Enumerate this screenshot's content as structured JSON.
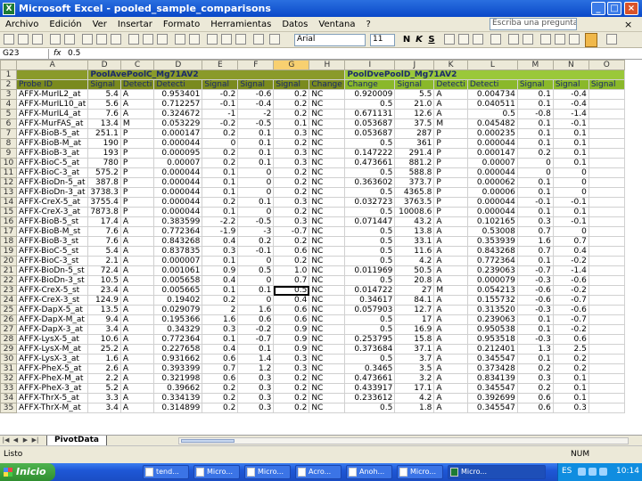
{
  "window": {
    "title": "Microsoft Excel - pooled_sample_comparisons",
    "app_icon_letter": "X",
    "min_label": "_",
    "max_label": "□",
    "close_label": "×"
  },
  "menu": {
    "items": [
      "Archivo",
      "Edición",
      "Ver",
      "Insertar",
      "Formato",
      "Herramientas",
      "Datos",
      "Ventana",
      "?"
    ],
    "help_placeholder": "Escriba una pregunta",
    "close_glyph": "×"
  },
  "toolbar": {
    "font": "Arial",
    "size": "11",
    "bold": "N",
    "italic": "K",
    "underline": "S"
  },
  "formula_bar": {
    "name_box": "G23",
    "fx": "fx",
    "content": "0.5"
  },
  "columns": [
    "",
    "A",
    "D",
    "C",
    "D",
    "E",
    "F",
    "G",
    "H",
    "I",
    "J",
    "K",
    "L",
    "M",
    "N",
    "O"
  ],
  "selected_column": "G",
  "group_row": {
    "row": "1",
    "group1": "PoolAvePoolC_Mg71AV2",
    "group2": "PoolDvePoolD_Mg71AV2"
  },
  "header_row": {
    "row": "2",
    "cells": [
      "Probe ID",
      "Signal",
      "Detecti",
      "Detecti",
      "Signal",
      "Signal",
      "Signal",
      "Change",
      "Change",
      "Signal",
      "Detecti",
      "Detecti",
      "Signal",
      "Signal",
      "Signal"
    ]
  },
  "rows": [
    {
      "n": "3",
      "c": [
        "AFFX-MurIL2_at",
        "5.4",
        "A",
        "0.953401",
        "-0.2",
        "-0.6",
        "0.2",
        "NC",
        "0.920009",
        "5.5",
        "A",
        "0.004734",
        "0.1",
        "-0.4"
      ]
    },
    {
      "n": "4",
      "c": [
        "AFFX-MurIL10_at",
        "5.6",
        "A",
        "0.712257",
        "-0.1",
        "-0.4",
        "0.2",
        "NC",
        "0.5",
        "21.0",
        "A",
        "0.040511",
        "0.1",
        "-0.4"
      ]
    },
    {
      "n": "5",
      "c": [
        "AFFX-MurIL4_at",
        "7.6",
        "A",
        "0.324672",
        "-1",
        "-2",
        "0.2",
        "NC",
        "0.671131",
        "12.6",
        "A",
        "0.5",
        "-0.8",
        "-1.4"
      ]
    },
    {
      "n": "6",
      "c": [
        "AFFX-MurFAS_at",
        "13.4",
        "M",
        "0.053229",
        "-0.2",
        "-0.5",
        "0.1",
        "NC",
        "0.053687",
        "37.5",
        "M",
        "0.045482",
        "0.1",
        "-0.1"
      ]
    },
    {
      "n": "7",
      "c": [
        "AFFX-BioB-5_at",
        "251.1",
        "P",
        "0.000147",
        "0.2",
        "0.1",
        "0.3",
        "NC",
        "0.053687",
        "287",
        "P",
        "0.000235",
        "0.1",
        "0.1"
      ]
    },
    {
      "n": "8",
      "c": [
        "AFFX-BioB-M_at",
        "190",
        "P",
        "0.000044",
        "0",
        "0.1",
        "0.2",
        "NC",
        "0.5",
        "361",
        "P",
        "0.000044",
        "0.1",
        "0.1"
      ]
    },
    {
      "n": "9",
      "c": [
        "AFFX-BioB-3_at",
        "193",
        "P",
        "0.000095",
        "0.2",
        "0.1",
        "0.3",
        "NC",
        "0.147222",
        "291.4",
        "P",
        "0.000147",
        "0.2",
        "0.1"
      ]
    },
    {
      "n": "10",
      "c": [
        "AFFX-BioC-5_at",
        "780",
        "P",
        "0.00007",
        "0.2",
        "0.1",
        "0.3",
        "NC",
        "0.473661",
        "881.2",
        "P",
        "0.00007",
        "0",
        "0.1"
      ]
    },
    {
      "n": "11",
      "c": [
        "AFFX-BioC-3_at",
        "575.2",
        "P",
        "0.000044",
        "0.1",
        "0",
        "0.2",
        "NC",
        "0.5",
        "588.8",
        "P",
        "0.000044",
        "0",
        "0"
      ]
    },
    {
      "n": "12",
      "c": [
        "AFFX-BioDn-5_at",
        "387.8",
        "P",
        "0.000044",
        "0.1",
        "0",
        "0.2",
        "NC",
        "0.363602",
        "373.7",
        "P",
        "0.000062",
        "0.1",
        "0"
      ]
    },
    {
      "n": "13",
      "c": [
        "AFFX-BioDn-3_at",
        "3738.3",
        "P",
        "0.000044",
        "0.1",
        "0",
        "0.2",
        "NC",
        "0.5",
        "4365.8",
        "P",
        "0.00006",
        "0.1",
        "0"
      ]
    },
    {
      "n": "14",
      "c": [
        "AFFX-CreX-5_at",
        "3755.4",
        "P",
        "0.000044",
        "0.2",
        "0.1",
        "0.3",
        "NC",
        "0.032723",
        "3763.5",
        "P",
        "0.000044",
        "-0.1",
        "-0.1"
      ]
    },
    {
      "n": "15",
      "c": [
        "AFFX-CreX-3_at",
        "7873.8",
        "P",
        "0.000044",
        "0.1",
        "0",
        "0.2",
        "NC",
        "0.5",
        "10008.6",
        "P",
        "0.000044",
        "0.1",
        "0.1"
      ]
    },
    {
      "n": "16",
      "c": [
        "AFFX-BioB-5_st",
        "17.4",
        "A",
        "0.383599",
        "-2.2",
        "-0.5",
        "0.3",
        "NC",
        "0.071447",
        "43.2",
        "A",
        "0.102165",
        "0.3",
        "-0.1"
      ]
    },
    {
      "n": "17",
      "c": [
        "AFFX-BioB-M_st",
        "7.6",
        "A",
        "0.772364",
        "-1.9",
        "-3",
        "-0.7",
        "NC",
        "0.5",
        "13.8",
        "A",
        "0.53008",
        "0.7",
        "0"
      ]
    },
    {
      "n": "18",
      "c": [
        "AFFX-BioB-3_st",
        "7.6",
        "A",
        "0.843268",
        "0.4",
        "0.2",
        "0.2",
        "NC",
        "0.5",
        "33.1",
        "A",
        "0.353939",
        "1.6",
        "0.7"
      ]
    },
    {
      "n": "19",
      "c": [
        "AFFX-BioC-5_st",
        "5.4",
        "A",
        "0.837835",
        "0.3",
        "-0.1",
        "0.6",
        "NC",
        "0.5",
        "11.6",
        "A",
        "0.843268",
        "0.7",
        "0.4"
      ]
    },
    {
      "n": "20",
      "c": [
        "AFFX-BioC-3_st",
        "2.1",
        "A",
        "0.000007",
        "0.1",
        "0",
        "0.2",
        "NC",
        "0.5",
        "4.2",
        "A",
        "0.772364",
        "0.1",
        "-0.2"
      ]
    },
    {
      "n": "21",
      "c": [
        "AFFX-BioDn-5_st",
        "72.4",
        "A",
        "0.001061",
        "0.9",
        "0.5",
        "1.0",
        "NC",
        "0.011969",
        "50.5",
        "A",
        "0.239063",
        "-0.7",
        "-1.4"
      ]
    },
    {
      "n": "22",
      "c": [
        "AFFX-BioDn-3_st",
        "10.5",
        "A",
        "0.005658",
        "0.4",
        "0",
        "0.7",
        "NC",
        "0.5",
        "20.8",
        "A",
        "0.000079",
        "-0.3",
        "-0.6"
      ]
    },
    {
      "n": "23",
      "c": [
        "AFFX-CreX-5_st",
        "23.4",
        "A",
        "0.005665",
        "0.1",
        "0.1",
        "0.5",
        "NC",
        "0.014722",
        "27",
        "M",
        "0.054213",
        "-0.6",
        "-0.2"
      ]
    },
    {
      "n": "24",
      "c": [
        "AFFX-CreX-3_st",
        "124.9",
        "A",
        "0.19402",
        "0.2",
        "0",
        "0.4",
        "NC",
        "0.34617",
        "84.1",
        "A",
        "0.155732",
        "-0.6",
        "-0.7"
      ]
    },
    {
      "n": "25",
      "c": [
        "AFFX-DapX-5_at",
        "13.5",
        "A",
        "0.029079",
        "2",
        "1.6",
        "0.6",
        "NC",
        "0.057903",
        "12.7",
        "A",
        "0.313520",
        "-0.3",
        "-0.6"
      ]
    },
    {
      "n": "26",
      "c": [
        "AFFX-DapX-M_at",
        "9.4",
        "A",
        "0.195366",
        "1.6",
        "0.6",
        "0.6",
        "NC",
        "0.5",
        "17",
        "A",
        "0.239063",
        "0.1",
        "-0.7"
      ]
    },
    {
      "n": "27",
      "c": [
        "AFFX-DapX-3_at",
        "3.4",
        "A",
        "0.34329",
        "0.3",
        "-0.2",
        "0.9",
        "NC",
        "0.5",
        "16.9",
        "A",
        "0.950538",
        "0.1",
        "-0.2"
      ]
    },
    {
      "n": "28",
      "c": [
        "AFFX-LysX-5_at",
        "10.6",
        "A",
        "0.772364",
        "0.1",
        "-0.7",
        "0.9",
        "NC",
        "0.253795",
        "15.8",
        "A",
        "0.953518",
        "-0.3",
        "0.6"
      ]
    },
    {
      "n": "29",
      "c": [
        "AFFX-LysX-M_at",
        "25.2",
        "A",
        "0.227658",
        "0.4",
        "0.1",
        "0.9",
        "NC",
        "0.373684",
        "37.1",
        "A",
        "0.212401",
        "1.3",
        "2.5"
      ]
    },
    {
      "n": "30",
      "c": [
        "AFFX-LysX-3_at",
        "1.6",
        "A",
        "0.931662",
        "0.6",
        "1.4",
        "0.3",
        "NC",
        "0.5",
        "3.7",
        "A",
        "0.345547",
        "0.1",
        "0.2"
      ]
    },
    {
      "n": "31",
      "c": [
        "AFFX-PheX-5_at",
        "2.6",
        "A",
        "0.393399",
        "0.7",
        "1.2",
        "0.3",
        "NC",
        "0.3465",
        "3.5",
        "A",
        "0.373428",
        "0.2",
        "0.2"
      ]
    },
    {
      "n": "32",
      "c": [
        "AFFX-PheX-M_at",
        "2.2",
        "A",
        "0.321998",
        "0.6",
        "0.3",
        "0.2",
        "NC",
        "0.473661",
        "3.2",
        "A",
        "0.834139",
        "0.3",
        "0.1"
      ]
    },
    {
      "n": "33",
      "c": [
        "AFFX-PheX-3_at",
        "5.2",
        "A",
        "0.39662",
        "0.2",
        "0.3",
        "0.2",
        "NC",
        "0.433917",
        "17.1",
        "A",
        "0.345547",
        "0.2",
        "0.1"
      ]
    },
    {
      "n": "34",
      "c": [
        "AFFX-ThrX-5_at",
        "3.3",
        "A",
        "0.334139",
        "0.2",
        "0.3",
        "0.2",
        "NC",
        "0.233612",
        "4.2",
        "A",
        "0.392699",
        "0.6",
        "0.1"
      ]
    },
    {
      "n": "35",
      "c": [
        "AFFX-ThrX-M_at",
        "3.4",
        "A",
        "0.314899",
        "0.2",
        "0.3",
        "0.2",
        "NC",
        "0.5",
        "1.8",
        "A",
        "0.345547",
        "0.6",
        "0.3"
      ]
    }
  ],
  "active_cell": {
    "row": "23",
    "col": "G"
  },
  "sheet_tab": "PivotData",
  "status": {
    "left": "Listo",
    "right": "NUM"
  },
  "taskbar": {
    "start": "Inicio",
    "tasks": [
      "tend...",
      "Micro...",
      "Micro...",
      "Acro...",
      "Anoh...",
      "Micro...",
      "Micro..."
    ],
    "lang": "ES",
    "clock": "10:14"
  }
}
